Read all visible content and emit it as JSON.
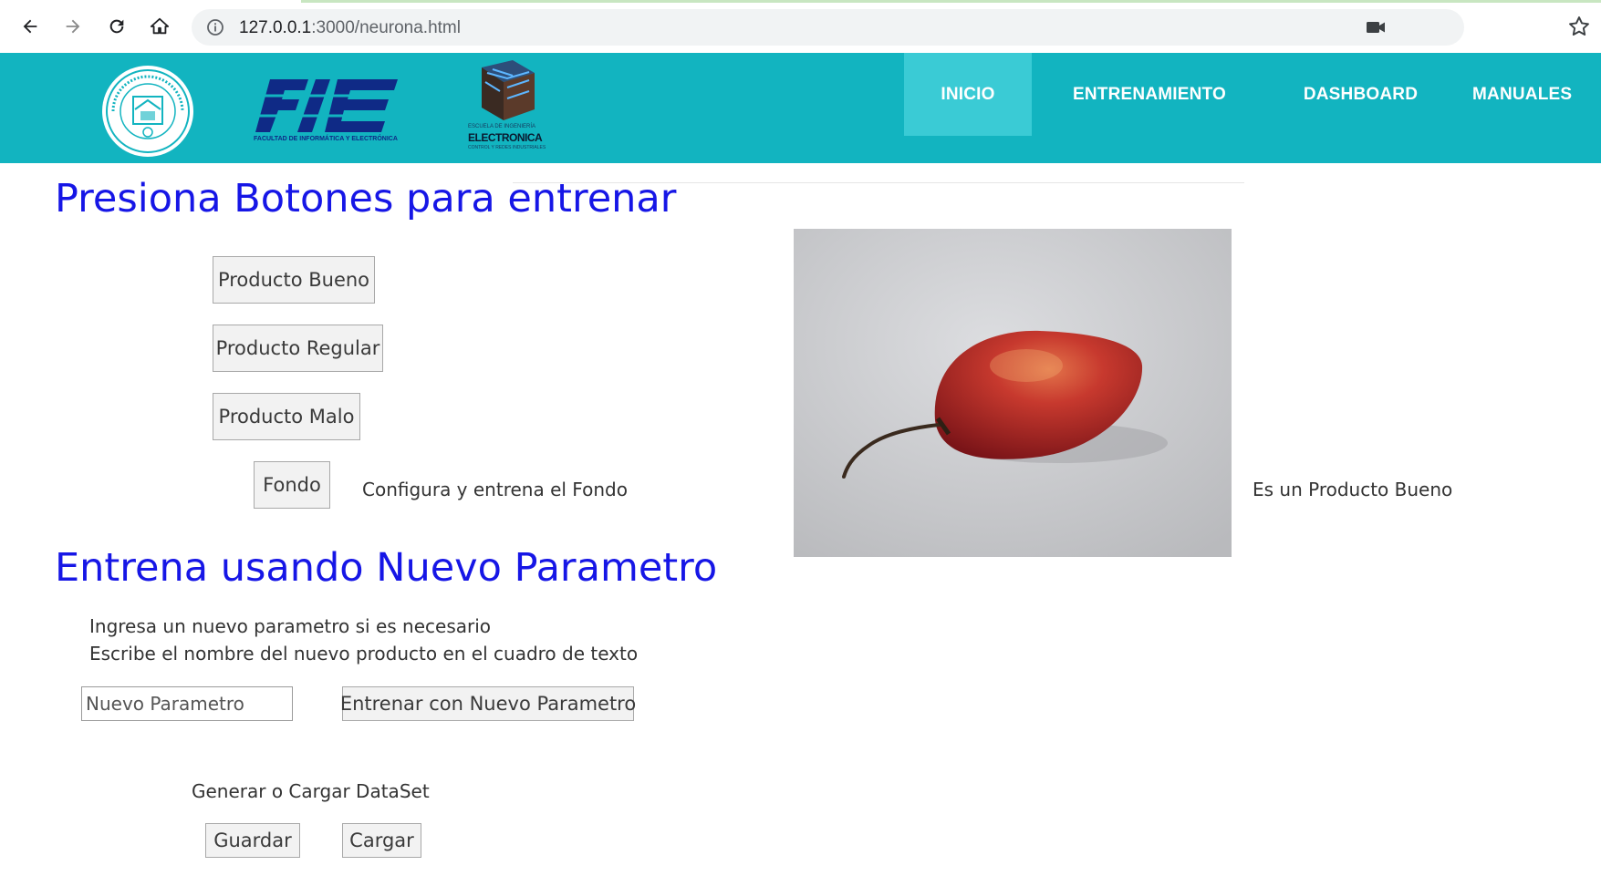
{
  "browser": {
    "url_host": "127.0.0.1",
    "url_rest": ":3000/neurona.html",
    "icons": [
      "back-arrow-icon",
      "forward-arrow-icon",
      "reload-icon",
      "home-icon",
      "info-icon",
      "camera-icon",
      "star-icon"
    ]
  },
  "header": {
    "logos": {
      "fie_caption": "FACULTAD DE INFORMÁTICA Y ELECTRÓNICA",
      "elec_line1": "ESCUELA DE INGENIERÍA",
      "elec_line2": "ELECTRONICA",
      "elec_line3": "CONTROL Y REDES INDUSTRIALES"
    },
    "menu": [
      {
        "label": "INICIO",
        "active": true
      },
      {
        "label": "ENTRENAMIENTO",
        "active": false
      },
      {
        "label": "DASHBOARD",
        "active": false
      },
      {
        "label": "MANUALES",
        "active": false
      }
    ],
    "colors": {
      "bar": "#12b4c0",
      "active": "#3acbd5"
    }
  },
  "main": {
    "title1": "Presiona Botones para entrenar",
    "buttons": {
      "bueno": "Producto Bueno",
      "regular": "Producto Regular",
      "malo": "Producto Malo",
      "fondo": "Fondo"
    },
    "fondo_note": "Configura y entrena el Fondo",
    "prediction": "Es un Producto Bueno",
    "title2": "Entrena usando Nuevo Parametro",
    "instructions": {
      "line1": "Ingresa un nuevo parametro si es necesario",
      "line2": "Escribe el nombre del nuevo producto en el cuadro de texto"
    },
    "new_param_placeholder": "Nuevo Parametro",
    "train_new_button": "Entrenar con Nuevo Parametro",
    "dataset_label": "Generar o Cargar DataSet",
    "save_button": "Guardar",
    "load_button": "Cargar",
    "title_color": "#1616e6"
  }
}
